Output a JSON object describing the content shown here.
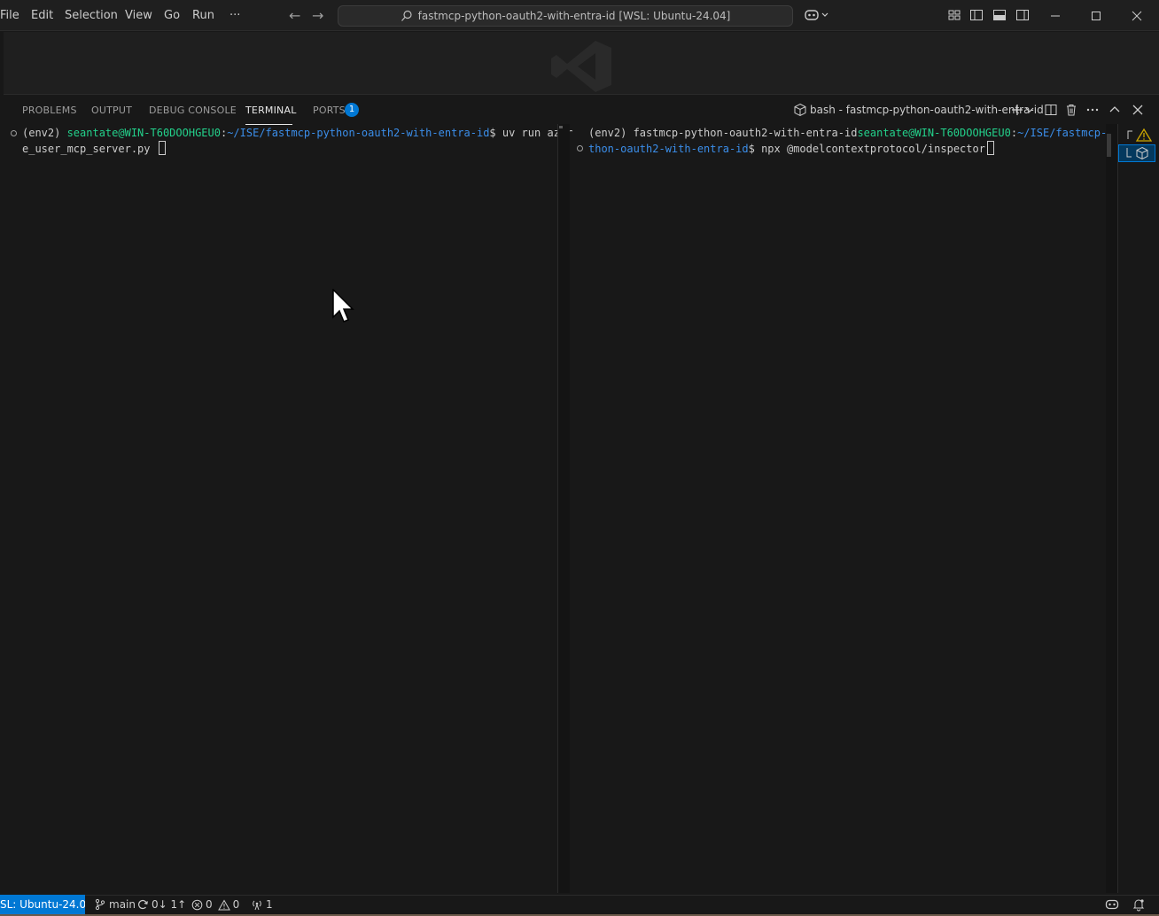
{
  "menu": [
    "File",
    "Edit",
    "Selection",
    "View",
    "Go",
    "Run",
    "···"
  ],
  "command_center": {
    "text": "fastmcp-python-oauth2-with-entra-id [WSL: Ubuntu-24.04]"
  },
  "panel": {
    "tabs": [
      {
        "label": "PROBLEMS"
      },
      {
        "label": "OUTPUT"
      },
      {
        "label": "DEBUG CONSOLE"
      },
      {
        "label": "TERMINAL"
      },
      {
        "label": "PORTS",
        "badge": "1"
      }
    ],
    "terminal_name": "bash - fastmcp-python-oauth2-with-entra-id"
  },
  "terminal_left": {
    "env": "(env2) ",
    "user": "seantate@WIN-T60DOOHGEU0",
    "colon": ":",
    "path": "~/ISE/fastmcp-python-oauth2-with-entra-id",
    "prompt": "$ ",
    "command_line1": "uv run azur",
    "command_line2": "e_user_mcp_server.py "
  },
  "terminal_right": {
    "env": "(env2) fastmcp-python-oauth2-with-entra-id",
    "user": "seantate@WIN-T60DOOHGEU0",
    "colon": ":",
    "path_line1": "~/ISE/fastmcp-py",
    "path_line2": "thon-oauth2-with-entra-id",
    "prompt": "$ ",
    "command": "npx @modelcontextprotocol/inspector"
  },
  "statusbar": {
    "remote": "SL: Ubuntu-24.04",
    "branch": "main",
    "sync": "0↓ 1↑",
    "errors": "0",
    "warnings": "0",
    "ports": "1"
  },
  "colors": {
    "accent": "#0078d4",
    "prompt_user": "#23d18b",
    "prompt_path": "#3b8eea",
    "warning": "#cca700"
  }
}
